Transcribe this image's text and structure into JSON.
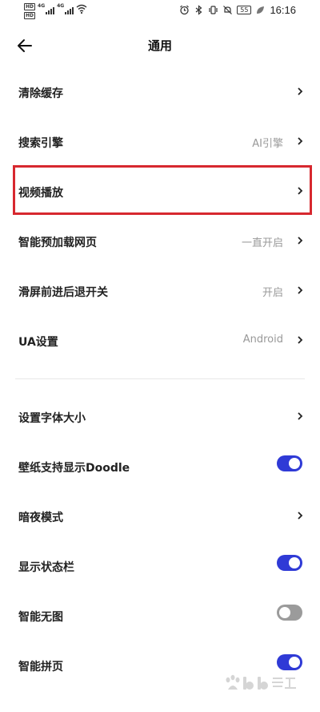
{
  "status_bar": {
    "hd_top": "HD",
    "hd_bottom": "HD",
    "net1": "4G",
    "net2": "4G",
    "battery": "55",
    "time": "16:16"
  },
  "header": {
    "title": "通用"
  },
  "items": [
    {
      "label": "清除缓存",
      "value": "",
      "control": "chevron"
    },
    {
      "label": "搜索引擎",
      "value": "AI引擎",
      "control": "chevron"
    },
    {
      "label": "视频播放",
      "value": "",
      "control": "chevron"
    },
    {
      "label": "智能预加载网页",
      "value": "一直开启",
      "control": "chevron"
    },
    {
      "label": "滑屏前进后退开关",
      "value": "开启",
      "control": "chevron"
    },
    {
      "label": "UA设置",
      "value": "Android",
      "control": "chevron"
    }
  ],
  "items2": [
    {
      "label": "设置字体大小",
      "control": "chevron"
    },
    {
      "label": "壁纸支持显示Doodle",
      "control": "toggle",
      "on": true
    },
    {
      "label": "暗夜模式",
      "control": "chevron"
    },
    {
      "label": "显示状态栏",
      "control": "toggle",
      "on": true
    },
    {
      "label": "智能无图",
      "control": "toggle",
      "on": false
    },
    {
      "label": "智能拼页",
      "control": "toggle",
      "on": true
    }
  ],
  "colors": {
    "accent": "#2f3ad6",
    "toggle_off": "#9b9b9b",
    "highlight": "#d7282f"
  },
  "watermark": {
    "logo": "Bai du 经验"
  }
}
